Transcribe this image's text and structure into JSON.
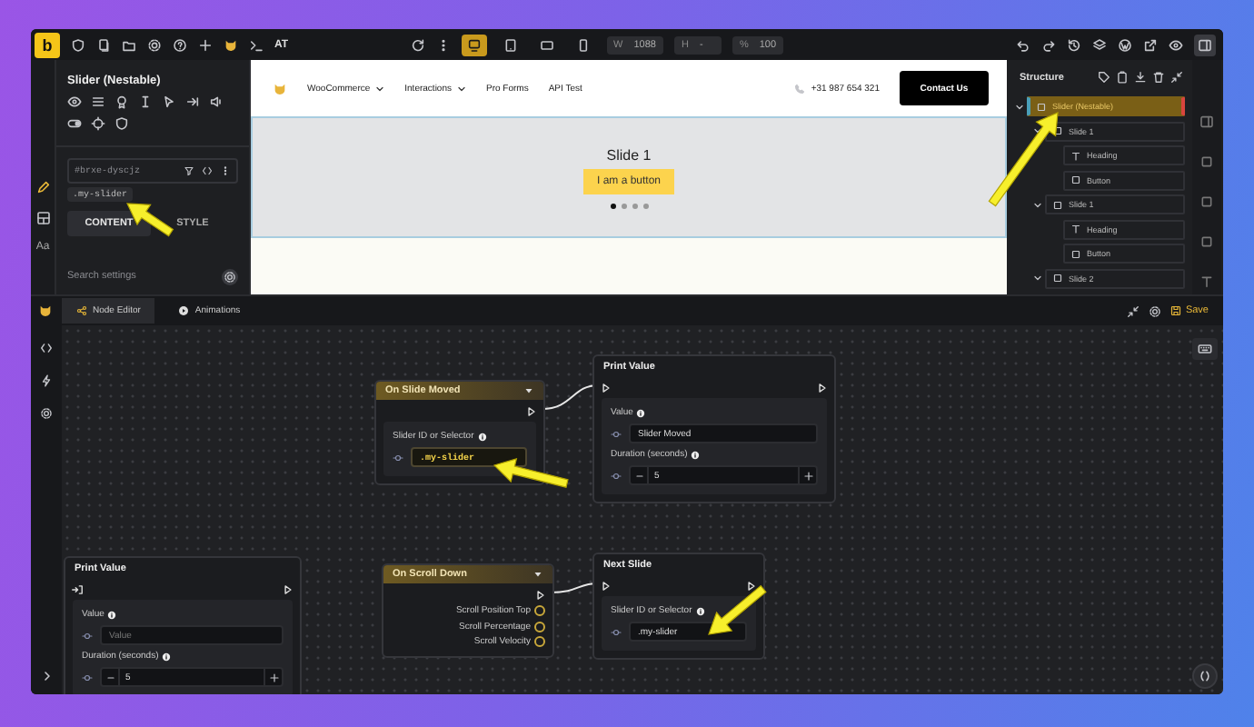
{
  "toolbar": {
    "logo": "b",
    "project": "AT",
    "devices": [
      {
        "kind": "desktop",
        "selected": true
      },
      {
        "kind": "tablet",
        "selected": false
      },
      {
        "kind": "landscape",
        "selected": false
      },
      {
        "kind": "phone",
        "selected": false
      }
    ],
    "size_fields": [
      {
        "label": "W",
        "value": "1088"
      },
      {
        "label": "H",
        "value": "-"
      },
      {
        "label": "%",
        "value": "100"
      }
    ]
  },
  "side_rail": [
    {
      "kind": "edit",
      "selected": true
    },
    {
      "kind": "layout",
      "selected": false
    },
    {
      "kind": "text",
      "label": "Aa",
      "selected": false
    }
  ],
  "element_panel": {
    "title": "Slider (Nestable)",
    "id_field": "#brxe-dyscjz",
    "class_chip": ".my-slider",
    "tabs": [
      {
        "label": "CONTENT",
        "selected": true
      },
      {
        "label": "STYLE",
        "selected": false
      }
    ],
    "search": {
      "placeholder": "Search settings"
    }
  },
  "preview": {
    "nav": [
      {
        "label": "WooCommerce",
        "dropdown": true
      },
      {
        "label": "Interactions",
        "dropdown": true
      },
      {
        "label": "Pro Forms",
        "dropdown": false
      },
      {
        "label": "API Test",
        "dropdown": false
      }
    ],
    "phone": "+31 987 654 321",
    "cta": "Contact Us",
    "slide": {
      "heading": "Slide 1",
      "button": "I am a button"
    },
    "dots": [
      {
        "selected": true
      },
      {
        "selected": false
      },
      {
        "selected": false
      },
      {
        "selected": false
      }
    ]
  },
  "structure": {
    "title": "Structure",
    "tree": [
      {
        "label": "Slider (Nestable)",
        "kind": "block",
        "selected": true,
        "expanded": true,
        "children": [
          {
            "label": "Slide 1",
            "kind": "block",
            "selected": false,
            "expanded": true,
            "children": [
              {
                "label": "Heading",
                "kind": "heading",
                "selected": false
              },
              {
                "label": "Button",
                "kind": "button",
                "selected": false
              }
            ]
          },
          {
            "label": "Slide 1",
            "kind": "block",
            "selected": false,
            "expanded": true,
            "children": [
              {
                "label": "Heading",
                "kind": "heading",
                "selected": false
              },
              {
                "label": "Button",
                "kind": "button",
                "selected": false
              }
            ]
          },
          {
            "label": "Slide 2",
            "kind": "block",
            "selected": false,
            "expanded": true
          }
        ]
      }
    ]
  },
  "node_editor": {
    "tabs": [
      {
        "label": "Node Editor",
        "kind": "nodes",
        "selected": true
      },
      {
        "label": "Animations",
        "kind": "play",
        "selected": false
      }
    ],
    "save": "Save",
    "nodes": [
      {
        "kind": "event",
        "title": "On Slide Moved",
        "fields": [
          {
            "kind": "code",
            "label": "Slider ID or Selector",
            "value": ".my-slider"
          }
        ]
      },
      {
        "kind": "action",
        "title": "Print Value",
        "fields": [
          {
            "kind": "text",
            "label": "Value",
            "value": "Slider Moved"
          },
          {
            "kind": "number",
            "label": "Duration (seconds)",
            "value": "5"
          }
        ]
      },
      {
        "kind": "action",
        "title": "Print Value",
        "fields": [
          {
            "kind": "text",
            "label": "Value",
            "placeholder": "Value"
          },
          {
            "kind": "number",
            "label": "Duration (seconds)",
            "value": "5"
          }
        ]
      },
      {
        "kind": "event",
        "title": "On Scroll Down",
        "outputs": [
          "Scroll Position Top",
          "Scroll Percentage",
          "Scroll Velocity"
        ]
      },
      {
        "kind": "action",
        "title": "Next Slide",
        "fields": [
          {
            "kind": "text",
            "label": "Slider ID or Selector",
            "value": ".my-slider"
          }
        ]
      }
    ]
  }
}
